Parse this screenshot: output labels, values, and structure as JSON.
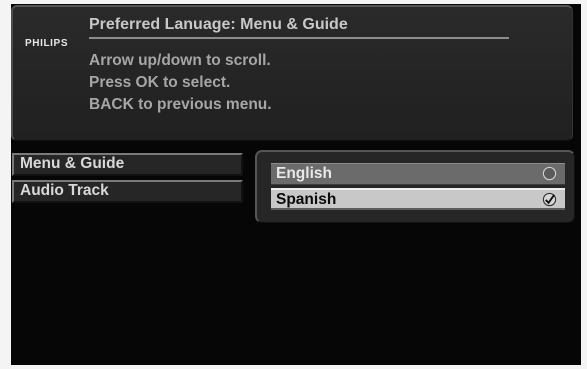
{
  "brand": "PHILIPS",
  "header": {
    "title": "Preferred Lanuage: Menu & Guide",
    "help_lines": [
      "Arrow up/down to scroll.",
      "Press OK to select.",
      "BACK to previous menu."
    ]
  },
  "menu": {
    "items": [
      {
        "label": "Menu & Guide"
      },
      {
        "label": "Audio Track"
      }
    ]
  },
  "options": {
    "items": [
      {
        "label": "English",
        "selected": false,
        "icon": "radio-empty-icon"
      },
      {
        "label": "Spanish",
        "selected": true,
        "icon": "radio-checked-icon"
      }
    ]
  },
  "colors": {
    "background": "#060606",
    "highlight": "#c8c8c8",
    "option_normal": "#6b6b6b"
  }
}
